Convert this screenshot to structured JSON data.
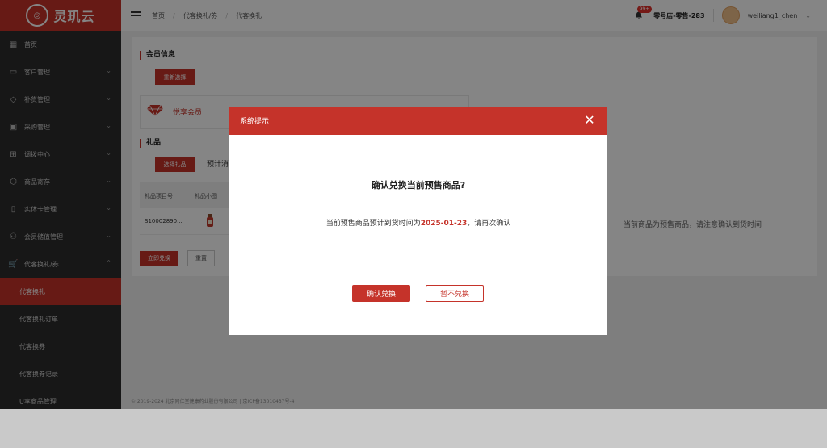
{
  "brand": {
    "name": "灵玑云"
  },
  "sidebar": {
    "items": [
      {
        "label": "首页",
        "icon": "grid-icon"
      },
      {
        "label": "客户管理",
        "icon": "id-card-icon"
      },
      {
        "label": "补货管理",
        "icon": "diamond-icon"
      },
      {
        "label": "采购管理",
        "icon": "calendar-icon"
      },
      {
        "label": "调拨中心",
        "icon": "apps-icon"
      },
      {
        "label": "商品寄存",
        "icon": "box-icon"
      },
      {
        "label": "实体卡管理",
        "icon": "book-icon"
      },
      {
        "label": "会员储值管理",
        "icon": "users-icon"
      },
      {
        "label": "代客换礼/券",
        "icon": "cart-icon"
      }
    ],
    "subitems": [
      {
        "label": "代客换礼"
      },
      {
        "label": "代客换礼订单"
      },
      {
        "label": "代客换券"
      },
      {
        "label": "代客换券记录"
      },
      {
        "label": "U享商品管理"
      }
    ]
  },
  "header": {
    "breadcrumb": [
      "首页",
      "代客换礼/券",
      "代客换礼"
    ],
    "notification_badge": "99+",
    "store": "零号店-零售-283",
    "user": "weiliang1_chen"
  },
  "content": {
    "member_section_title": "会员信息",
    "reselect_button": "重新选择",
    "member_level": "悦享会员",
    "gift_section_title": "礼品",
    "select_gift_button": "选择礼品",
    "pending_text": "预计消",
    "table_headers": [
      "礼品项目号",
      "礼品小图"
    ],
    "table_row": {
      "code": "S10002890..."
    },
    "redeem_button": "立即兑换",
    "reset_button": "重置",
    "right_note": "当前商品为预售商品，请注意确认到货时间"
  },
  "footer": {
    "text": "© 2019-2024 北京同仁堂健康药业股份有限公司 | 京ICP备13010437号-4"
  },
  "modal": {
    "title": "系统提示",
    "question": "确认兑换当前预售商品?",
    "message_prefix": "当前预售商品预计到货时间为",
    "message_date": "2025-01-23",
    "message_suffix": "，请再次确认",
    "confirm_button": "确认兑换",
    "cancel_button": "暂不兑换"
  },
  "colors": {
    "brand_red": "#c5332a",
    "sidebar_bg": "#2c2c2c"
  }
}
